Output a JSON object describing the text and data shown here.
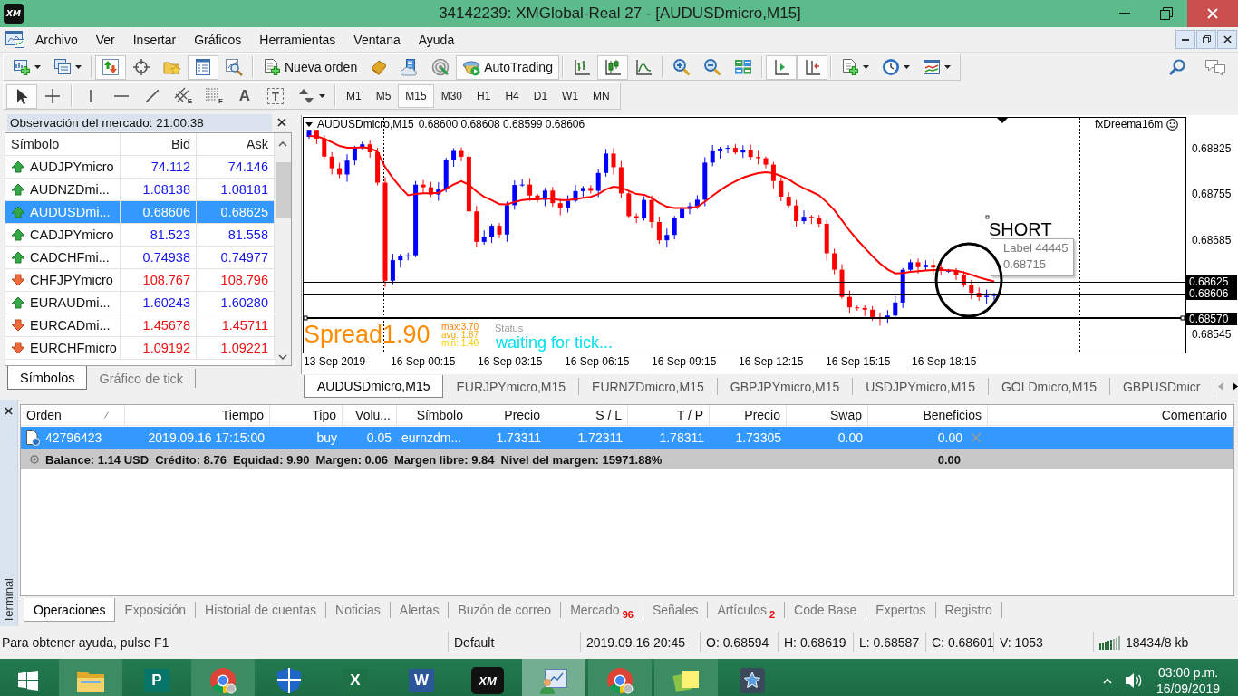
{
  "window": {
    "logo": "XM",
    "title": "34142239: XMGlobal-Real 27 - [AUDUSDmicro,M15]"
  },
  "menu": {
    "items": [
      "Archivo",
      "Ver",
      "Insertar",
      "Gráficos",
      "Herramientas",
      "Ventana",
      "Ayuda"
    ]
  },
  "toolbar_main": {
    "groups": [
      [
        {
          "kind": "new-chart",
          "pressed": false,
          "dropdown": true
        },
        {
          "kind": "profiles",
          "pressed": false,
          "dropdown": true
        }
      ],
      [
        {
          "kind": "market-watch",
          "pressed": true,
          "dropdown": false
        },
        {
          "kind": "navigator",
          "pressed": false,
          "dropdown": false
        },
        {
          "kind": "favorites",
          "pressed": false,
          "dropdown": false
        },
        {
          "kind": "data-window",
          "pressed": true,
          "dropdown": false
        },
        {
          "kind": "tester",
          "pressed": false,
          "dropdown": false
        }
      ],
      [
        {
          "kind": "new-order",
          "label": "Nueva orden",
          "pressed": false,
          "dropdown": false
        },
        {
          "kind": "editor",
          "pressed": false,
          "dropdown": false
        },
        {
          "kind": "cloud",
          "pressed": false,
          "dropdown": false
        },
        {
          "kind": "signals",
          "pressed": false,
          "dropdown": false
        },
        {
          "kind": "autotrading",
          "label": "AutoTrading",
          "pressed": true,
          "dropdown": false
        }
      ],
      [
        {
          "kind": "bar-chart",
          "pressed": false,
          "dropdown": false
        },
        {
          "kind": "candles",
          "pressed": true,
          "dropdown": false
        },
        {
          "kind": "line-chart",
          "pressed": false,
          "dropdown": false
        }
      ],
      [
        {
          "kind": "zoom-in",
          "pressed": false,
          "dropdown": false
        },
        {
          "kind": "zoom-out",
          "pressed": false,
          "dropdown": false
        },
        {
          "kind": "tile",
          "pressed": false,
          "dropdown": false
        }
      ],
      [
        {
          "kind": "shift",
          "pressed": true,
          "dropdown": false
        },
        {
          "kind": "autoscroll",
          "pressed": true,
          "dropdown": false
        }
      ],
      [
        {
          "kind": "indicators",
          "pressed": false,
          "dropdown": true
        },
        {
          "kind": "periods",
          "pressed": false,
          "dropdown": true
        },
        {
          "kind": "templates",
          "pressed": false,
          "dropdown": true
        }
      ]
    ],
    "right": [
      {
        "kind": "search"
      },
      {
        "kind": "chat"
      }
    ]
  },
  "toolbar_draw": {
    "groups": [
      [
        {
          "kind": "cursor",
          "pressed": true,
          "dropdown": false
        },
        {
          "kind": "crosshair",
          "pressed": false,
          "dropdown": false
        }
      ],
      [
        {
          "kind": "vline",
          "pressed": false,
          "dropdown": false
        },
        {
          "kind": "hline",
          "pressed": false,
          "dropdown": false
        },
        {
          "kind": "trendline",
          "pressed": false,
          "dropdown": false
        },
        {
          "kind": "channel",
          "glyph": "E",
          "pressed": false,
          "dropdown": false
        },
        {
          "kind": "fibo",
          "glyph": "F",
          "pressed": false,
          "dropdown": false
        },
        {
          "kind": "text",
          "glyph": "A",
          "pressed": false,
          "dropdown": false
        },
        {
          "kind": "label",
          "glyph": "T",
          "pressed": false,
          "dropdown": false
        },
        {
          "kind": "arrows",
          "pressed": false,
          "dropdown": true
        }
      ]
    ],
    "timeframes": [
      {
        "label": "M1",
        "selected": false
      },
      {
        "label": "M5",
        "selected": false
      },
      {
        "label": "M15",
        "selected": true
      },
      {
        "label": "M30",
        "selected": false
      },
      {
        "label": "H1",
        "selected": false
      },
      {
        "label": "H4",
        "selected": false
      },
      {
        "label": "D1",
        "selected": false
      },
      {
        "label": "W1",
        "selected": false
      },
      {
        "label": "MN",
        "selected": false
      }
    ]
  },
  "market_watch": {
    "title": "Observación del mercado: 21:00:38",
    "columns": [
      "Símbolo",
      "Bid",
      "Ask"
    ],
    "rows": [
      {
        "symbol": "AUDJPYmicro",
        "bid": "74.112",
        "ask": "74.146",
        "rising": true,
        "selected": false
      },
      {
        "symbol": "AUDNZDmi...",
        "bid": "1.08138",
        "ask": "1.08181",
        "rising": true,
        "selected": false
      },
      {
        "symbol": "AUDUSDmi...",
        "bid": "0.68606",
        "ask": "0.68625",
        "rising": true,
        "selected": true
      },
      {
        "symbol": "CADJPYmicro",
        "bid": "81.523",
        "ask": "81.558",
        "rising": true,
        "selected": false
      },
      {
        "symbol": "CADCHFmi...",
        "bid": "0.74938",
        "ask": "0.74977",
        "rising": true,
        "selected": false
      },
      {
        "symbol": "CHFJPYmicro",
        "bid": "108.767",
        "ask": "108.796",
        "rising": false,
        "selected": false
      },
      {
        "symbol": "EURAUDmi...",
        "bid": "1.60243",
        "ask": "1.60280",
        "rising": true,
        "selected": false
      },
      {
        "symbol": "EURCADmi...",
        "bid": "1.45678",
        "ask": "1.45711",
        "rising": false,
        "selected": false
      },
      {
        "symbol": "EURCHFmicro",
        "bid": "1.09192",
        "ask": "1.09221",
        "rising": false,
        "selected": false
      }
    ],
    "tabs": [
      {
        "label": "Símbolos",
        "selected": true
      },
      {
        "label": "Gráfico de tick",
        "selected": false
      }
    ]
  },
  "chart": {
    "header": {
      "symbol": "AUDUSDmicro,M15",
      "prices": "0.68600 0.68608 0.68599 0.68606"
    },
    "indicator": "fxDreema16m",
    "price_labels": [
      {
        "text": "0.68825",
        "kind": "tick"
      },
      {
        "text": "0.68755",
        "kind": "tick"
      },
      {
        "text": "0.68685",
        "kind": "tick"
      },
      {
        "text": "0.68625",
        "kind": "line"
      },
      {
        "text": "0.68606",
        "kind": "line"
      },
      {
        "text": "0.68570",
        "kind": "line"
      },
      {
        "text": "0.68545",
        "kind": "tick"
      }
    ],
    "time_labels": [
      "13 Sep 2019",
      "16 Sep 00:15",
      "16 Sep 03:15",
      "16 Sep 06:15",
      "16 Sep 09:15",
      "16 Sep 12:15",
      "16 Sep 15:15",
      "16 Sep 18:15"
    ],
    "object_label": "SHORT",
    "tooltip": [
      "Label 44445",
      "0.68715"
    ],
    "spread": {
      "value": "Spread1.90",
      "stats": [
        "max:3.70",
        "avg: 1.87",
        "min: 1.40"
      ],
      "status": "Status",
      "message": "waiting for tick..."
    },
    "tabs": [
      {
        "label": "AUDUSDmicro,M15",
        "selected": true
      },
      {
        "label": "EURJPYmicro,M15",
        "selected": false
      },
      {
        "label": "EURNZDmicro,M15",
        "selected": false
      },
      {
        "label": "GBPJPYmicro,M15",
        "selected": false
      },
      {
        "label": "USDJPYmicro,M15",
        "selected": false
      },
      {
        "label": "GOLDmicro,M15",
        "selected": false
      },
      {
        "label": "GBPUSDmicr",
        "selected": false
      }
    ],
    "tab_scroll": {
      "back_enabled": false,
      "forward_enabled": true
    }
  },
  "terminal": {
    "title": "Terminal",
    "columns": [
      "Orden",
      "Tiempo",
      "Tipo",
      "Volu...",
      "Símbolo",
      "Precio",
      "S / L",
      "T / P",
      "Precio",
      "Swap",
      "Beneficios",
      "Comentario"
    ],
    "rows": [
      {
        "cells": [
          "42796423",
          "2019.09.16 17:15:00",
          "buy",
          "0.05",
          "eurnzdm...",
          "1.73311",
          "1.72311",
          "1.78311",
          "1.73305",
          "0.00",
          "0.00"
        ],
        "selected": true
      }
    ],
    "summary": {
      "items": [
        "Balance: 1.14 USD",
        "Crédito: 8.76",
        "Equidad: 9.90",
        "Margen: 0.06",
        "Margen libre: 9.84",
        "Nivel del margen: 15971.88%"
      ],
      "profit": "0.00"
    },
    "tabs": [
      {
        "label": "Operaciones",
        "selected": true
      },
      {
        "label": "Exposición",
        "selected": false
      },
      {
        "label": "Historial de cuentas",
        "selected": false
      },
      {
        "label": "Noticias",
        "selected": false
      },
      {
        "label": "Alertas",
        "selected": false
      },
      {
        "label": "Buzón de correo",
        "selected": false
      },
      {
        "label": "Mercado",
        "badge": "96",
        "selected": false
      },
      {
        "label": "Señales",
        "selected": false
      },
      {
        "label": "Artículos",
        "badge": "2",
        "selected": false
      },
      {
        "label": "Code Base",
        "selected": false
      },
      {
        "label": "Expertos",
        "selected": false
      },
      {
        "label": "Registro",
        "selected": false
      }
    ]
  },
  "status_bar": {
    "help": "Para obtener ayuda, pulse F1",
    "profile": "Default",
    "datetime": "2019.09.16 20:45",
    "ohlcv": [
      "O: 0.68594",
      "H: 0.68619",
      "L: 0.68587",
      "C: 0.68601",
      "V: 1053"
    ],
    "traffic": "18434/8 kb"
  },
  "taskbar": {
    "apps": [
      {
        "kind": "folder",
        "running": true,
        "selected": false
      },
      {
        "kind": "p-tile",
        "glyph": "P",
        "running": false,
        "selected": false
      },
      {
        "kind": "round",
        "running": true,
        "selected": false
      },
      {
        "kind": "shield",
        "running": false,
        "selected": false
      },
      {
        "kind": "x-tile",
        "glyph": "X",
        "running": false,
        "selected": false
      },
      {
        "kind": "w-tile",
        "glyph": "W",
        "running": false,
        "selected": false
      },
      {
        "kind": "logo-tile",
        "glyph": "XM",
        "running": false,
        "selected": false
      },
      {
        "kind": "person-chart",
        "running": true,
        "selected": true
      },
      {
        "kind": "round",
        "running": true,
        "selected": false
      },
      {
        "kind": "notes",
        "running": true,
        "selected": false
      },
      {
        "kind": "star",
        "running": false,
        "selected": false
      }
    ],
    "time": "03:00 p.m.",
    "date": "16/09/2019"
  }
}
